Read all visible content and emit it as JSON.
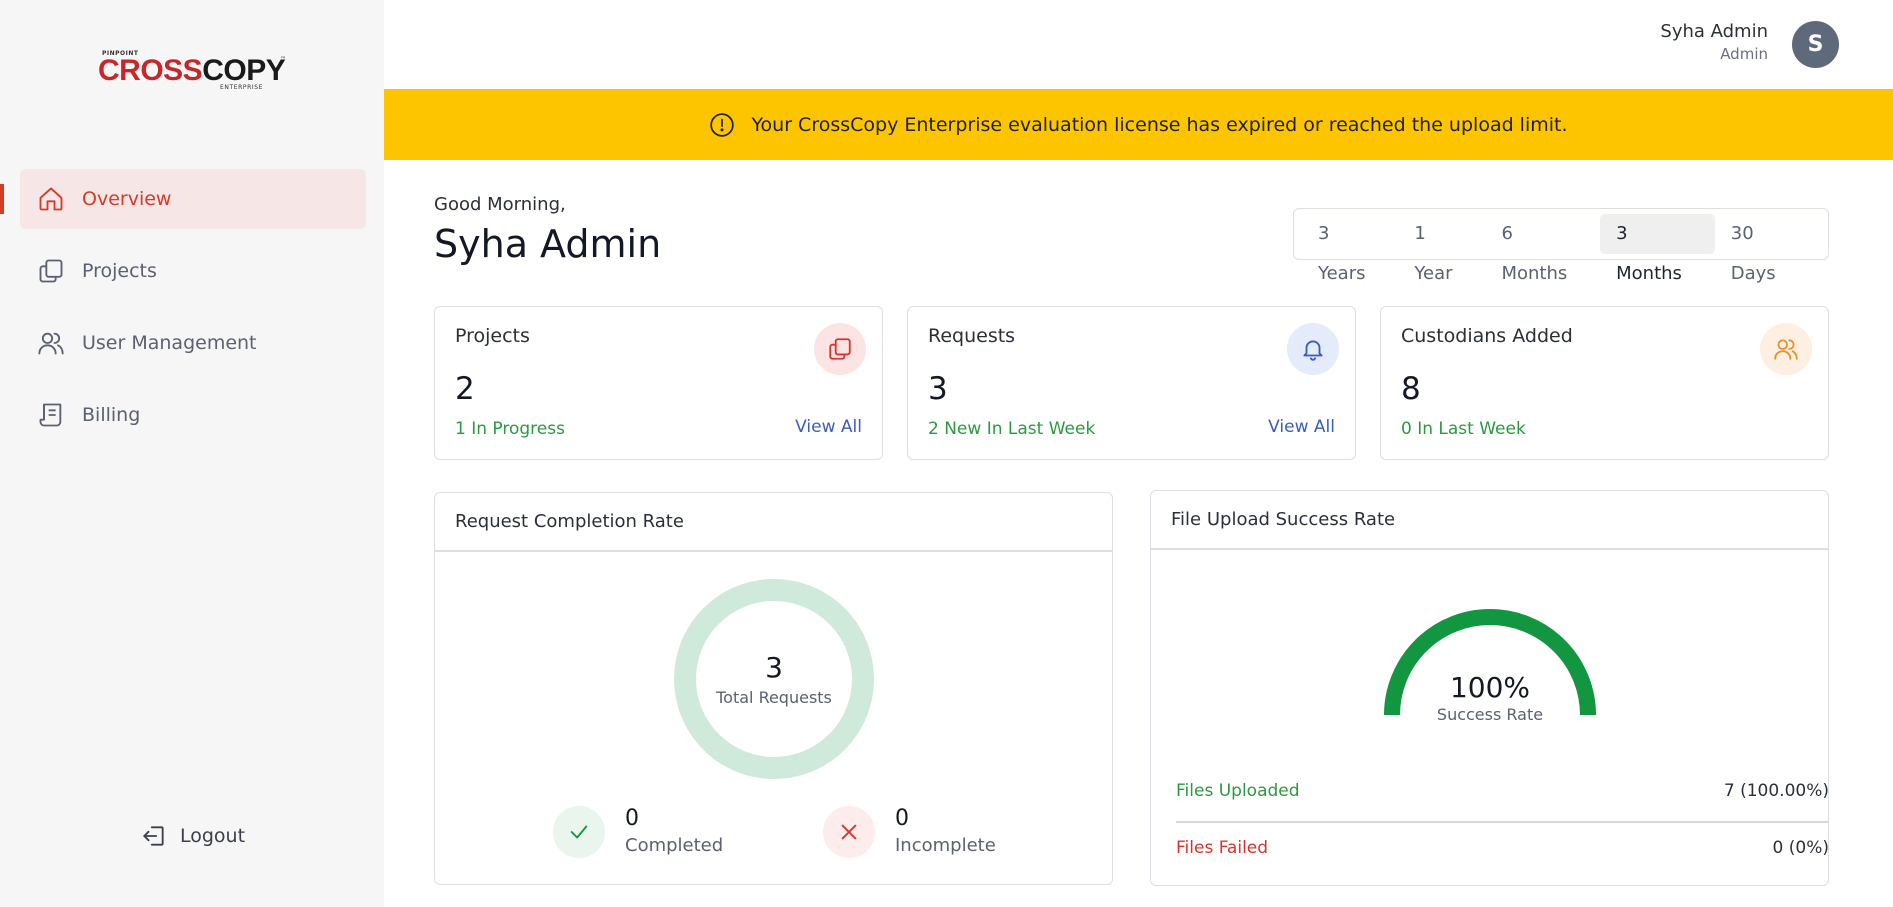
{
  "brand": {
    "pre": "PINPOINT",
    "cross": "CROSS",
    "copy": "COPY",
    "tm": "™",
    "edition": "ENTERPRISE"
  },
  "sidebar": {
    "items": [
      {
        "label": "Overview",
        "icon": "home-icon",
        "active": true
      },
      {
        "label": "Projects",
        "icon": "projects-icon",
        "active": false
      },
      {
        "label": "User Management",
        "icon": "users-icon",
        "active": false
      },
      {
        "label": "Billing",
        "icon": "billing-icon",
        "active": false
      }
    ],
    "logout": "Logout"
  },
  "header": {
    "user_name": "Syha Admin",
    "user_role": "Admin",
    "avatar_initial": "S"
  },
  "banner": {
    "message": "Your CrossCopy Enterprise evaluation license has expired or reached the upload limit.",
    "color": "#fdc500"
  },
  "main": {
    "greeting": "Good Morning,",
    "title": "Syha Admin",
    "ranges": [
      "3 Years",
      "1 Year",
      "6 Months",
      "3 Months",
      "30 Days"
    ],
    "active_range": "3 Months"
  },
  "cards": {
    "projects": {
      "title": "Projects",
      "value": "2",
      "sub": "1 In Progress",
      "link": "View All"
    },
    "requests": {
      "title": "Requests",
      "value": "3",
      "sub": "2 New In Last Week",
      "link": "View All"
    },
    "custodians": {
      "title": "Custodians Added",
      "value": "8",
      "sub": "0 In Last Week"
    }
  },
  "request_completion": {
    "title": "Request Completion Rate",
    "total": "3",
    "total_label": "Total Requests",
    "completed_value": "0",
    "completed_label": "Completed",
    "incomplete_value": "0",
    "incomplete_label": "Incomplete"
  },
  "file_upload": {
    "title": "File Upload Success Rate",
    "rate": "100%",
    "rate_label": "Success Rate",
    "success_fraction": 1.0,
    "uploaded_label": "Files Uploaded",
    "uploaded_value": "7 (100.00%)",
    "failed_label": "Files Failed",
    "failed_value": "0 (0%)"
  },
  "colors": {
    "accent": "#d43c28",
    "success": "#12963f",
    "danger": "#d9342b",
    "link": "#3b5bc4"
  }
}
